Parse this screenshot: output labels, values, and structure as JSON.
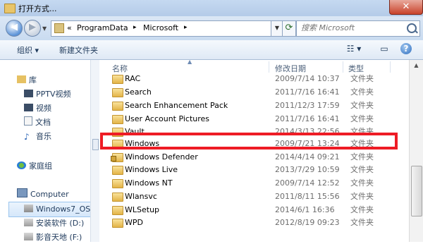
{
  "window": {
    "title": "打开方式...",
    "close_glyph": "✕"
  },
  "address": {
    "segments": [
      "«",
      "ProgramData",
      "▸",
      "Microsoft",
      "▸"
    ],
    "search_placeholder": "搜索 Microsoft"
  },
  "toolbar": {
    "organize": "组织 ▾",
    "new_folder": "新建文件夹",
    "views": "☷ ▾",
    "preview": "▭",
    "help": "?"
  },
  "nav": [
    {
      "label": "库",
      "icon": "library-icon"
    },
    {
      "label": "PPTV视频",
      "icon": "video-library-icon"
    },
    {
      "label": "视频",
      "icon": "video-library-icon"
    },
    {
      "label": "文档",
      "icon": "documents-icon"
    },
    {
      "label": "音乐",
      "icon": "music-icon"
    },
    {
      "label": "家庭组",
      "icon": "homegroup-icon"
    },
    {
      "label": "Computer",
      "icon": "computer-icon"
    },
    {
      "label": "Windows7_OS",
      "icon": "drive-icon"
    },
    {
      "label": "安装软件 (D:)",
      "icon": "drive-icon"
    },
    {
      "label": "影音天地 (F:)",
      "icon": "drive-icon"
    }
  ],
  "columns": {
    "name": "名称",
    "date": "修改日期",
    "type": "类型"
  },
  "files": [
    {
      "name": "RAC",
      "date": "2009/7/14 10:37",
      "type": "文件夹"
    },
    {
      "name": "Search",
      "date": "2011/7/16 16:41",
      "type": "文件夹"
    },
    {
      "name": "Search Enhancement Pack",
      "date": "2011/12/3 17:59",
      "type": "文件夹"
    },
    {
      "name": "User Account Pictures",
      "date": "2011/7/16 16:41",
      "type": "文件夹"
    },
    {
      "name": "Vault",
      "date": "2014/3/13 22:56",
      "type": "文件夹"
    },
    {
      "name": "Windows",
      "date": "2009/7/21 13:24",
      "type": "文件夹"
    },
    {
      "name": "Windows Defender",
      "date": "2014/4/14 09:21",
      "type": "文件夹"
    },
    {
      "name": "Windows Live",
      "date": "2013/7/29 10:59",
      "type": "文件夹"
    },
    {
      "name": "Windows NT",
      "date": "2009/7/14 12:52",
      "type": "文件夹"
    },
    {
      "name": "Wlansvc",
      "date": "2011/8/11 15:56",
      "type": "文件夹"
    },
    {
      "name": "WLSetup",
      "date": "2014/6/1 16:36",
      "type": "文件夹"
    },
    {
      "name": "WPD",
      "date": "2012/8/19 09:23",
      "type": "文件夹"
    }
  ],
  "colors": {
    "highlight": "#ee1c25",
    "accent": "#1e395b"
  }
}
